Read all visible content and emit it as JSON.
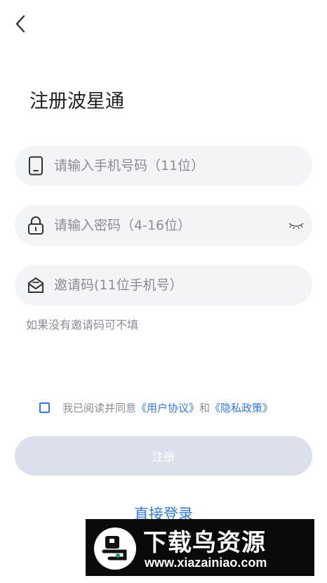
{
  "header": {
    "title": "注册波星通"
  },
  "form": {
    "phone_placeholder": "请输入手机号码（11位）",
    "password_placeholder": "请输入密码（4-16位）",
    "invite_placeholder": "邀请码(11位手机号）",
    "invite_hint": "如果没有邀请码可不填"
  },
  "agreement": {
    "prefix": "我已阅读并同意",
    "user_agreement": "《用户协议》",
    "and": "和",
    "privacy_policy": "《隐私政策》"
  },
  "actions": {
    "register_label": "注册",
    "login_link": "直接登录"
  },
  "watermark": {
    "title": "下载鸟资源",
    "url": "www.xiazainiao.com"
  },
  "colors": {
    "accent": "#2f78ea",
    "field_bg": "#f3f4f6",
    "button_disabled": "#dcdfec",
    "placeholder": "#8a8d93"
  },
  "icons": {
    "back": "chevron-left-icon",
    "phone": "phone-icon",
    "lock": "lock-icon",
    "eye": "eye-closed-icon",
    "invite": "envelope-icon"
  }
}
